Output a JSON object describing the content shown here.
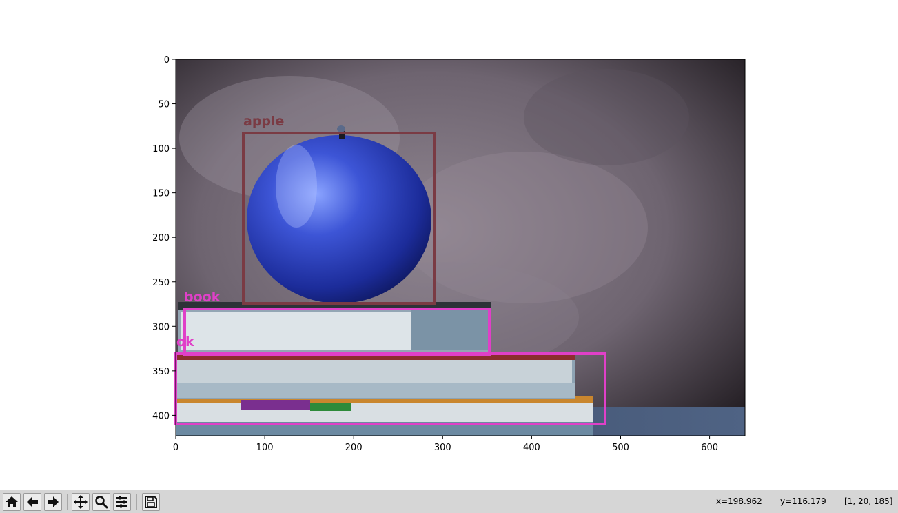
{
  "plot": {
    "x_ticks": [
      "0",
      "100",
      "200",
      "300",
      "400",
      "500",
      "600"
    ],
    "y_ticks": [
      "0",
      "50",
      "100",
      "150",
      "200",
      "250",
      "300",
      "350",
      "400"
    ]
  },
  "detections": [
    {
      "label": "apple",
      "color": "#7a3b44"
    },
    {
      "label": "book",
      "color": "#e040c8"
    },
    {
      "label": "ok",
      "color": "#e040c8"
    },
    {
      "label": "",
      "color": "#e040c8"
    }
  ],
  "toolbar": {
    "buttons": [
      {
        "name": "home-button",
        "icon": "home-icon"
      },
      {
        "name": "back-button",
        "icon": "arrow-left-icon"
      },
      {
        "name": "forward-button",
        "icon": "arrow-right-icon"
      },
      {
        "name": "pan-button",
        "icon": "move-icon"
      },
      {
        "name": "zoom-button",
        "icon": "magnifier-icon"
      },
      {
        "name": "configure-subplots-button",
        "icon": "sliders-icon"
      },
      {
        "name": "save-button",
        "icon": "floppy-disk-icon"
      }
    ]
  },
  "status": {
    "x": "x=198.962",
    "y": "y=116.179",
    "pixel": "[1, 20, 185]"
  }
}
